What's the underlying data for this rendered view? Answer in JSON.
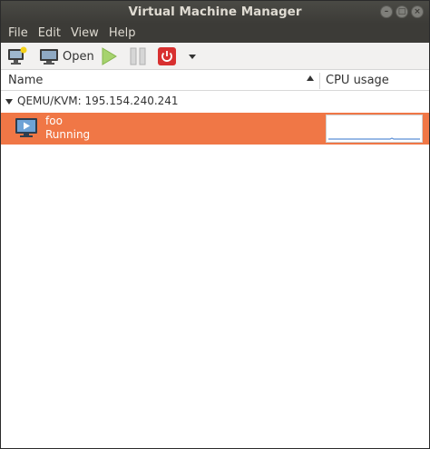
{
  "window": {
    "title": "Virtual Machine Manager"
  },
  "window_controls": {
    "minimize": "–",
    "maximize": "□",
    "close": "×"
  },
  "menu": [
    "File",
    "Edit",
    "View",
    "Help"
  ],
  "toolbar": {
    "open_label": "Open"
  },
  "columns": {
    "name": "Name",
    "cpu": "CPU usage"
  },
  "connection": {
    "label": "QEMU/KVM: 195.154.240.241"
  },
  "vms": [
    {
      "name": "foo",
      "status": "Running"
    }
  ],
  "colors": {
    "selection": "#f07746",
    "titlebar": "#3c3b37",
    "run_green": "#a6d36e",
    "shutdown_red": "#d83030",
    "graph_line": "#5b8fd6"
  }
}
